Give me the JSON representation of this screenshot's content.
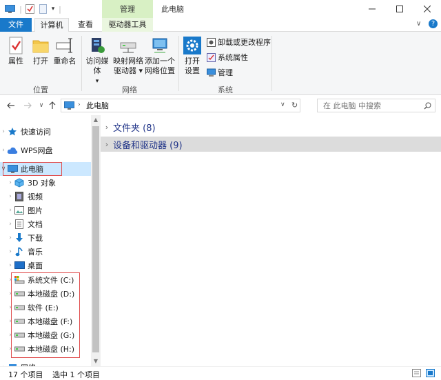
{
  "titlebar": {
    "manage_tab": "管理",
    "title": "此电脑"
  },
  "ribbon_tabs": {
    "file": "文件",
    "computer": "计算机",
    "view": "查看",
    "drive_tools": "驱动器工具"
  },
  "ribbon": {
    "location": {
      "properties": "属性",
      "open": "打开",
      "rename": "重命名",
      "label": "位置"
    },
    "network": {
      "access_media": "访问媒体",
      "map_drive_line1": "映射网络",
      "map_drive_line2": "驱动器",
      "add_location_line1": "添加一个",
      "add_location_line2": "网络位置",
      "label": "网络"
    },
    "system": {
      "open_settings_line1": "打开",
      "open_settings_line2": "设置",
      "uninstall": "卸载或更改程序",
      "sys_properties": "系统属性",
      "manage": "管理",
      "label": "系统"
    }
  },
  "address": {
    "path": "此电脑",
    "search_placeholder": "在 此电脑 中搜索"
  },
  "nav": {
    "quick_access": "快速访问",
    "wps": "WPS网盘",
    "this_pc": "此电脑",
    "objects3d": "3D 对象",
    "videos": "视频",
    "pictures": "图片",
    "documents": "文档",
    "downloads": "下载",
    "music": "音乐",
    "desktop": "桌面",
    "drives": [
      "系统文件 (C:)",
      "本地磁盘 (D:)",
      "软件 (E:)",
      "本地磁盘 (F:)",
      "本地磁盘 (G:)",
      "本地磁盘 (H:)"
    ],
    "network": "网络"
  },
  "content": {
    "folders_group": "文件夹 (8)",
    "devices_group": "设备和驱动器 (9)"
  },
  "status": {
    "item_count": "17 个项目",
    "selected": "选中 1 个项目"
  },
  "colors": {
    "file_tab": "#1979ca",
    "manage_tab": "#d8f0c4",
    "selection": "#cce8ff",
    "group_header_text": "#1e3287",
    "annotation_box": "#e05050"
  }
}
